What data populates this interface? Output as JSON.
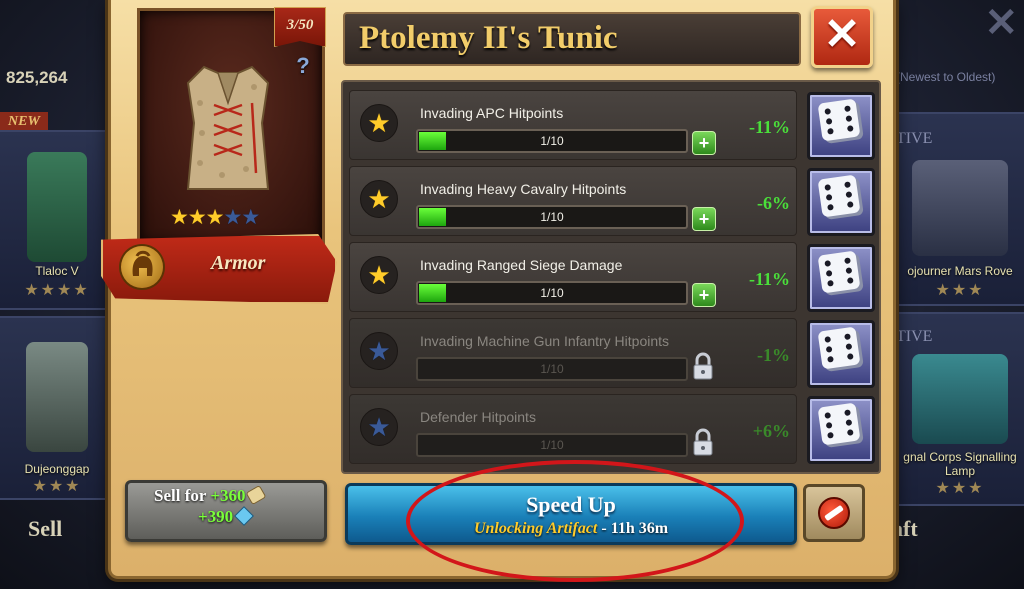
{
  "background": {
    "currency_value": "825,264",
    "sort_label": "(Newest to Oldest)",
    "new_badge": "NEW",
    "left_cards": [
      {
        "label": "Tlaloc V"
      },
      {
        "label": "Dujeonggap"
      }
    ],
    "right_cards": [
      {
        "tag": "TIVE",
        "label": "ojourner Mars Rove"
      },
      {
        "tag": "TIVE",
        "label": "gnal Corps Signalling Lamp"
      }
    ],
    "sell_text": "Sell",
    "craft_text": "aft"
  },
  "dialog": {
    "count_badge": "3/50",
    "help_icon": "?",
    "item_stars_filled": 3,
    "item_stars_total": 5,
    "category_label": "Armor",
    "title": "Ptolemy II's Tunic",
    "close_icon": "✕",
    "stats": [
      {
        "name": "Invading APC Hitpoints",
        "progress_text": "1/10",
        "progress": 0.1,
        "value": "-11%",
        "locked": false
      },
      {
        "name": "Invading Heavy Cavalry Hitpoints",
        "progress_text": "1/10",
        "progress": 0.1,
        "value": "-6%",
        "locked": false
      },
      {
        "name": "Invading Ranged Siege Damage",
        "progress_text": "1/10",
        "progress": 0.1,
        "value": "-11%",
        "locked": false
      },
      {
        "name": "Invading Machine Gun Infantry Hitpoints",
        "progress_text": "1/10",
        "progress": 0,
        "value": "-1%",
        "locked": true
      },
      {
        "name": "Defender Hitpoints",
        "progress_text": "1/10",
        "progress": 0,
        "value": "+6%",
        "locked": true
      }
    ],
    "sell": {
      "prefix": "Sell for",
      "amount1": "+360",
      "amount2": "+390"
    },
    "speed_up": {
      "label": "Speed Up",
      "status": "Unlocking Artifact",
      "separator": " - ",
      "time": "11h 36m"
    }
  },
  "colors": {
    "accent_gold": "#f2cd6a",
    "stat_positive": "#4adf3a",
    "annotation": "#d2161a"
  }
}
